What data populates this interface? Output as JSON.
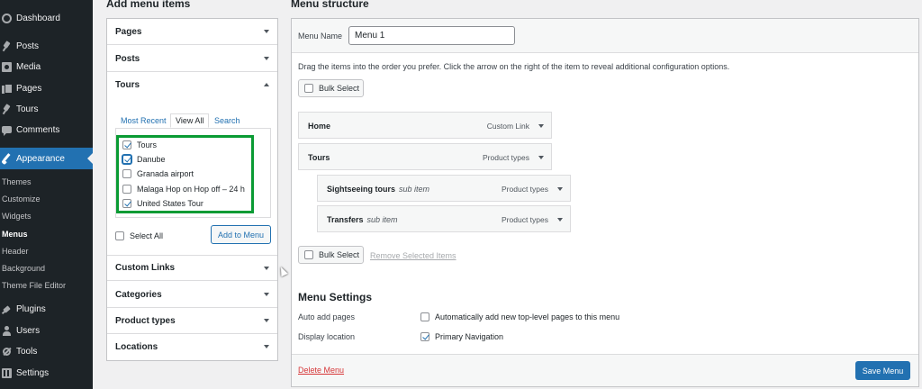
{
  "sidebar": {
    "items": [
      {
        "label": "Dashboard",
        "icon": "dashboard-icon"
      },
      {
        "label": "Posts",
        "icon": "pin-icon"
      },
      {
        "label": "Media",
        "icon": "media-icon"
      },
      {
        "label": "Pages",
        "icon": "pages-icon"
      },
      {
        "label": "Tours",
        "icon": "pin-icon"
      },
      {
        "label": "Comments",
        "icon": "comment-icon"
      },
      {
        "label": "Appearance",
        "icon": "brush-icon"
      },
      {
        "label": "Plugins",
        "icon": "plug-icon"
      },
      {
        "label": "Users",
        "icon": "user-icon"
      },
      {
        "label": "Tools",
        "icon": "wrench-icon"
      },
      {
        "label": "Settings",
        "icon": "settings-icon"
      }
    ],
    "appearance_sub": [
      "Themes",
      "Customize",
      "Widgets",
      "Menus",
      "Header",
      "Background",
      "Theme File Editor"
    ],
    "active_color": "#2271b1"
  },
  "add_items": {
    "title": "Add menu items",
    "sections": [
      "Pages",
      "Posts",
      "Tours",
      "Custom Links",
      "Categories",
      "Product types",
      "Locations"
    ],
    "tabs": [
      "Most Recent",
      "View All",
      "Search"
    ],
    "tour_items": [
      {
        "label": "Tours",
        "checked": true
      },
      {
        "label": "Danube",
        "checked": true
      },
      {
        "label": "Granada airport",
        "checked": false
      },
      {
        "label": "Malaga Hop on Hop off – 24 h",
        "checked": false
      },
      {
        "label": "United States Tour",
        "checked": true
      }
    ],
    "select_all": "Select All",
    "add_button": "Add to Menu",
    "highlight_color": "#0a9b34"
  },
  "structure": {
    "title": "Menu structure",
    "menu_name_label": "Menu Name",
    "menu_name_value": "Menu 1",
    "instructions": "Drag the items into the order you prefer. Click the arrow on the right of the item to reveal additional configuration options.",
    "bulk_select": "Bulk Select",
    "remove_selected": "Remove Selected Items",
    "items": [
      {
        "title": "Home",
        "sub": "",
        "kind": "Custom Link"
      },
      {
        "title": "Tours",
        "sub": "",
        "kind": "Product types"
      },
      {
        "title": "Sightseeing tours",
        "sub": "sub item",
        "kind": "Product types"
      },
      {
        "title": "Transfers",
        "sub": "sub item",
        "kind": "Product types"
      }
    ],
    "settings_title": "Menu Settings",
    "auto_add_label": "Auto add pages",
    "auto_add_text": "Automatically add new top-level pages to this menu",
    "display_label": "Display location",
    "display_text": "Primary Navigation",
    "delete_menu": "Delete Menu",
    "save_menu": "Save Menu"
  }
}
